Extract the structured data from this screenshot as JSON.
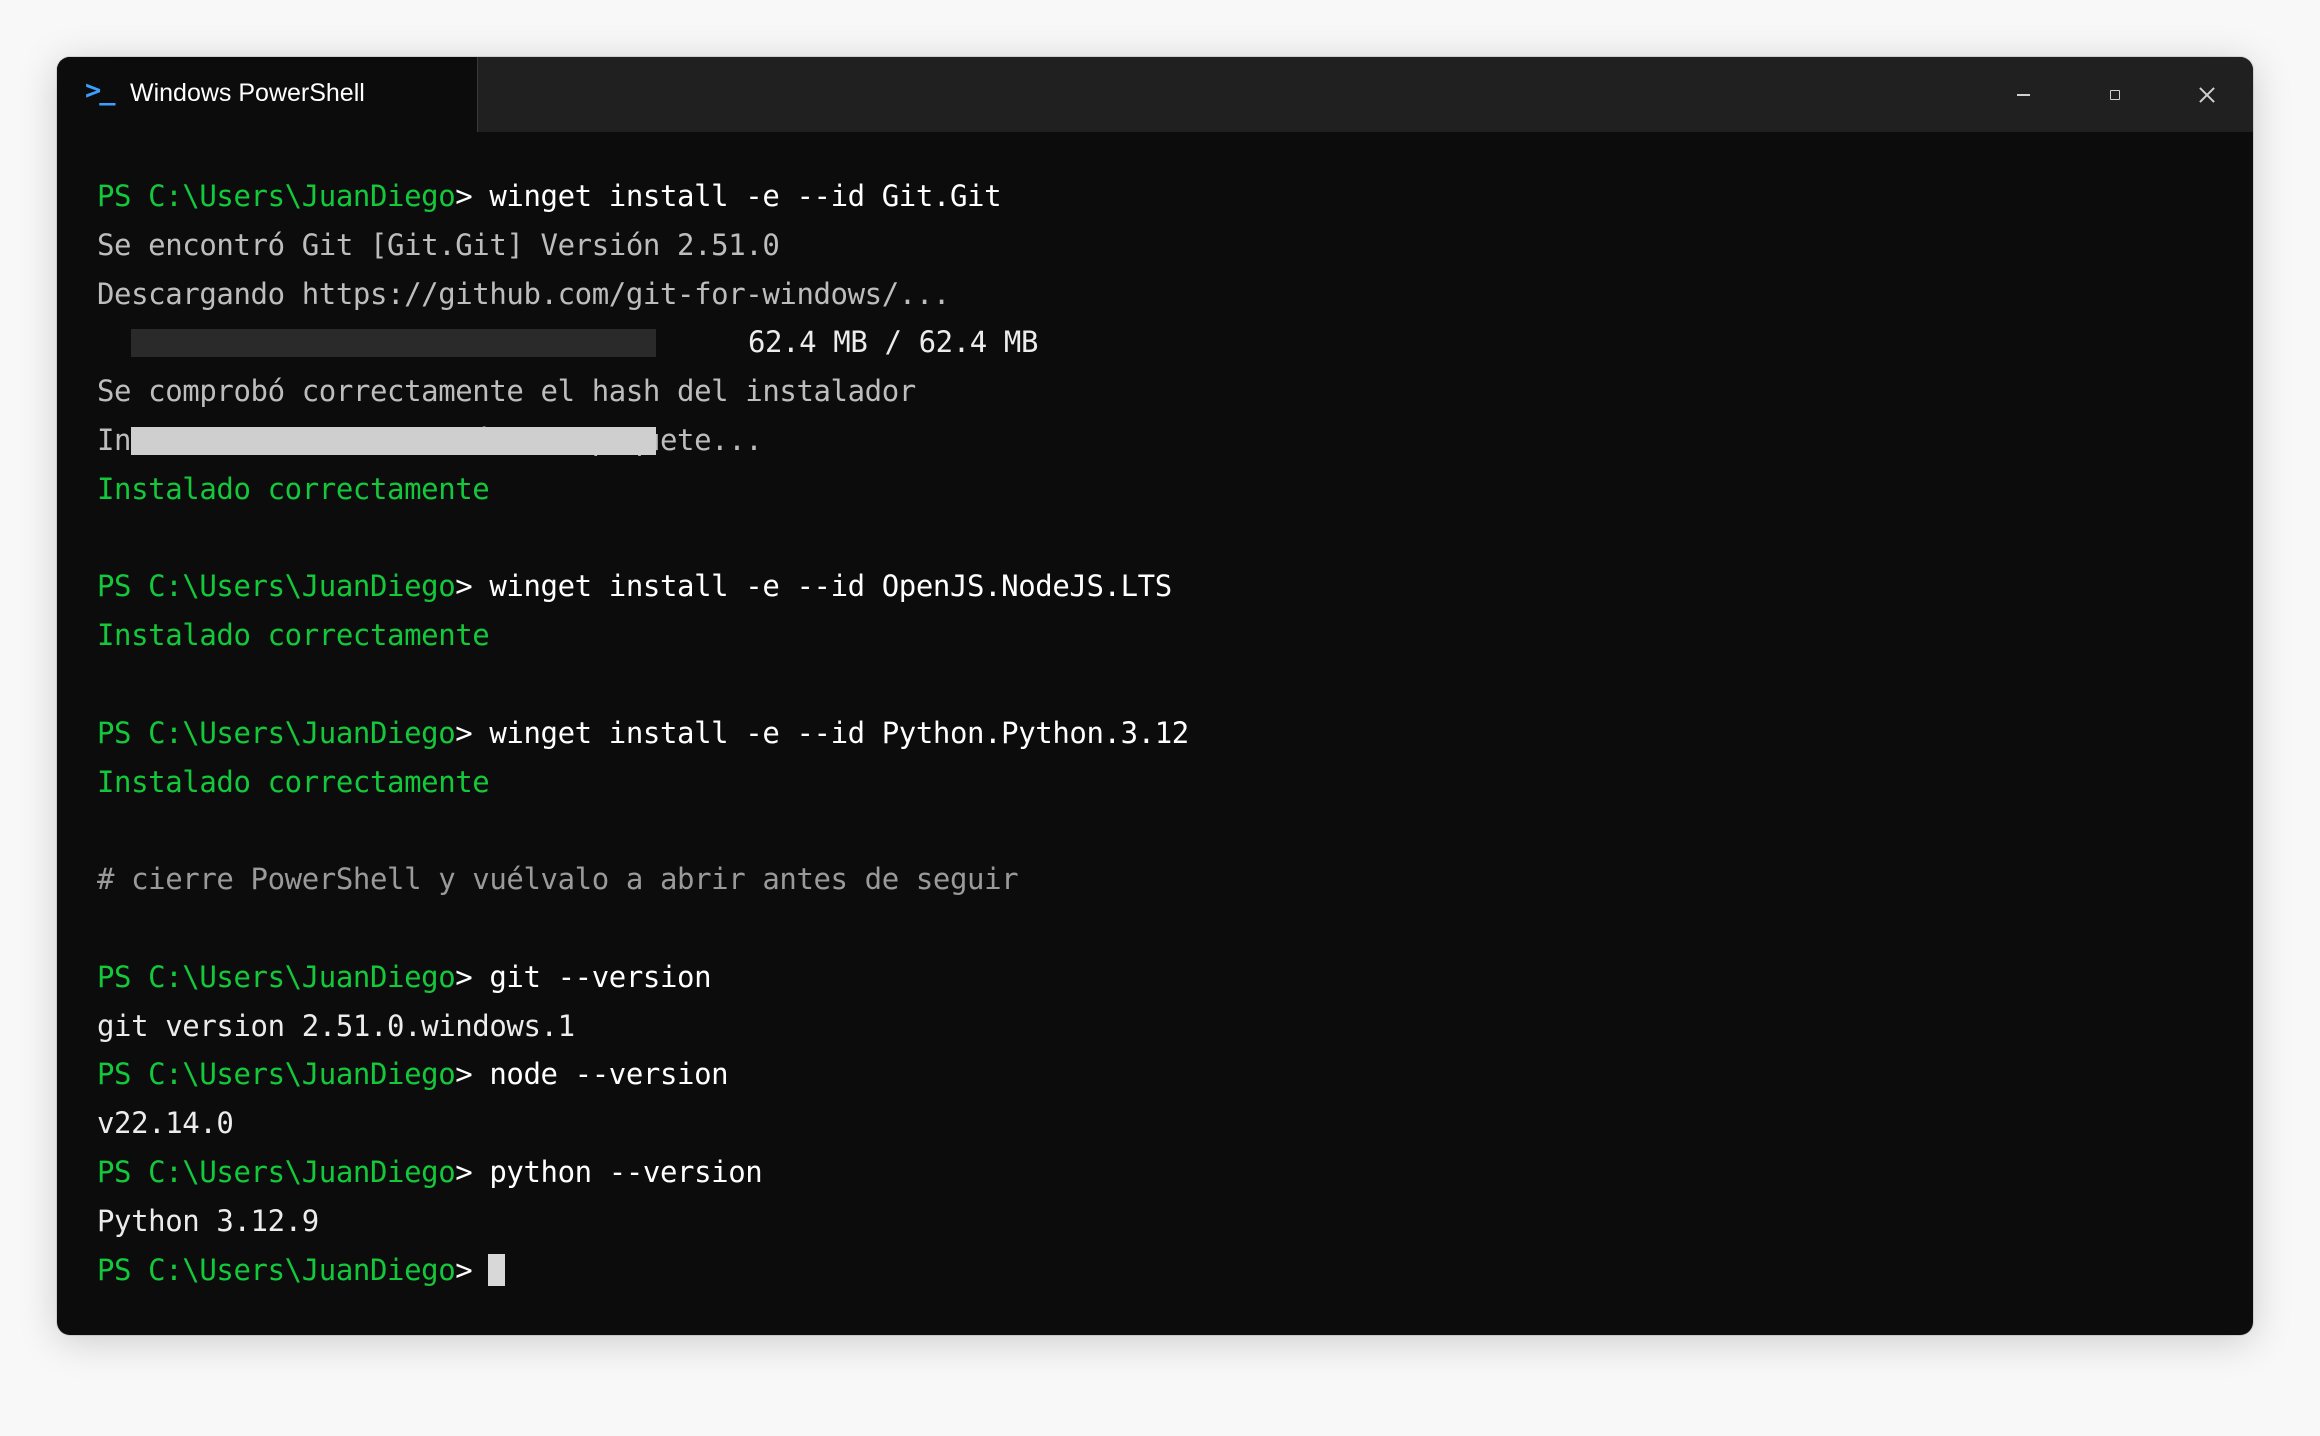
{
  "window": {
    "tab_title": "Windows PowerShell",
    "tab_icon": "powershell-prompt-icon",
    "controls": [
      "minimize-icon",
      "maximize-icon",
      "close-icon"
    ]
  },
  "colors": {
    "prompt": "#13c83a",
    "success": "#13c83a",
    "background": "#0c0c0c",
    "titlebar": "#202020"
  },
  "terminal": {
    "prompt": "PS C:\\Users\\JuanDiego",
    "prompt_suffix": ">",
    "blocks": {
      "git_install": {
        "command": "winget install -e --id Git.Git",
        "found": "Se encontró Git [Git.Git] Versión 2.51.0",
        "downloading": "Descargando https://github.com/git-for-windows/...",
        "progress_text": "62.4 MB / 62.4 MB",
        "progress_fraction": 1.0,
        "hash_ok": "Se comprobó correctamente el hash del instalador",
        "starting": "Iniciando la instalación del paquete...",
        "result": "Instalado correctamente"
      },
      "node_install": {
        "command": "winget install -e --id OpenJS.NodeJS.LTS",
        "result": "Instalado correctamente"
      },
      "python_install": {
        "command": "winget install -e --id Python.Python.3.12",
        "result": "Instalado correctamente"
      },
      "comment": "# cierre PowerShell y vuélvalo a abrir antes de seguir",
      "git_version": {
        "command": "git --version",
        "output": "git version 2.51.0.windows.1"
      },
      "node_version": {
        "command": "node --version",
        "output": "v22.14.0"
      },
      "python_version": {
        "command": "python --version",
        "output": "Python 3.12.9"
      }
    }
  }
}
